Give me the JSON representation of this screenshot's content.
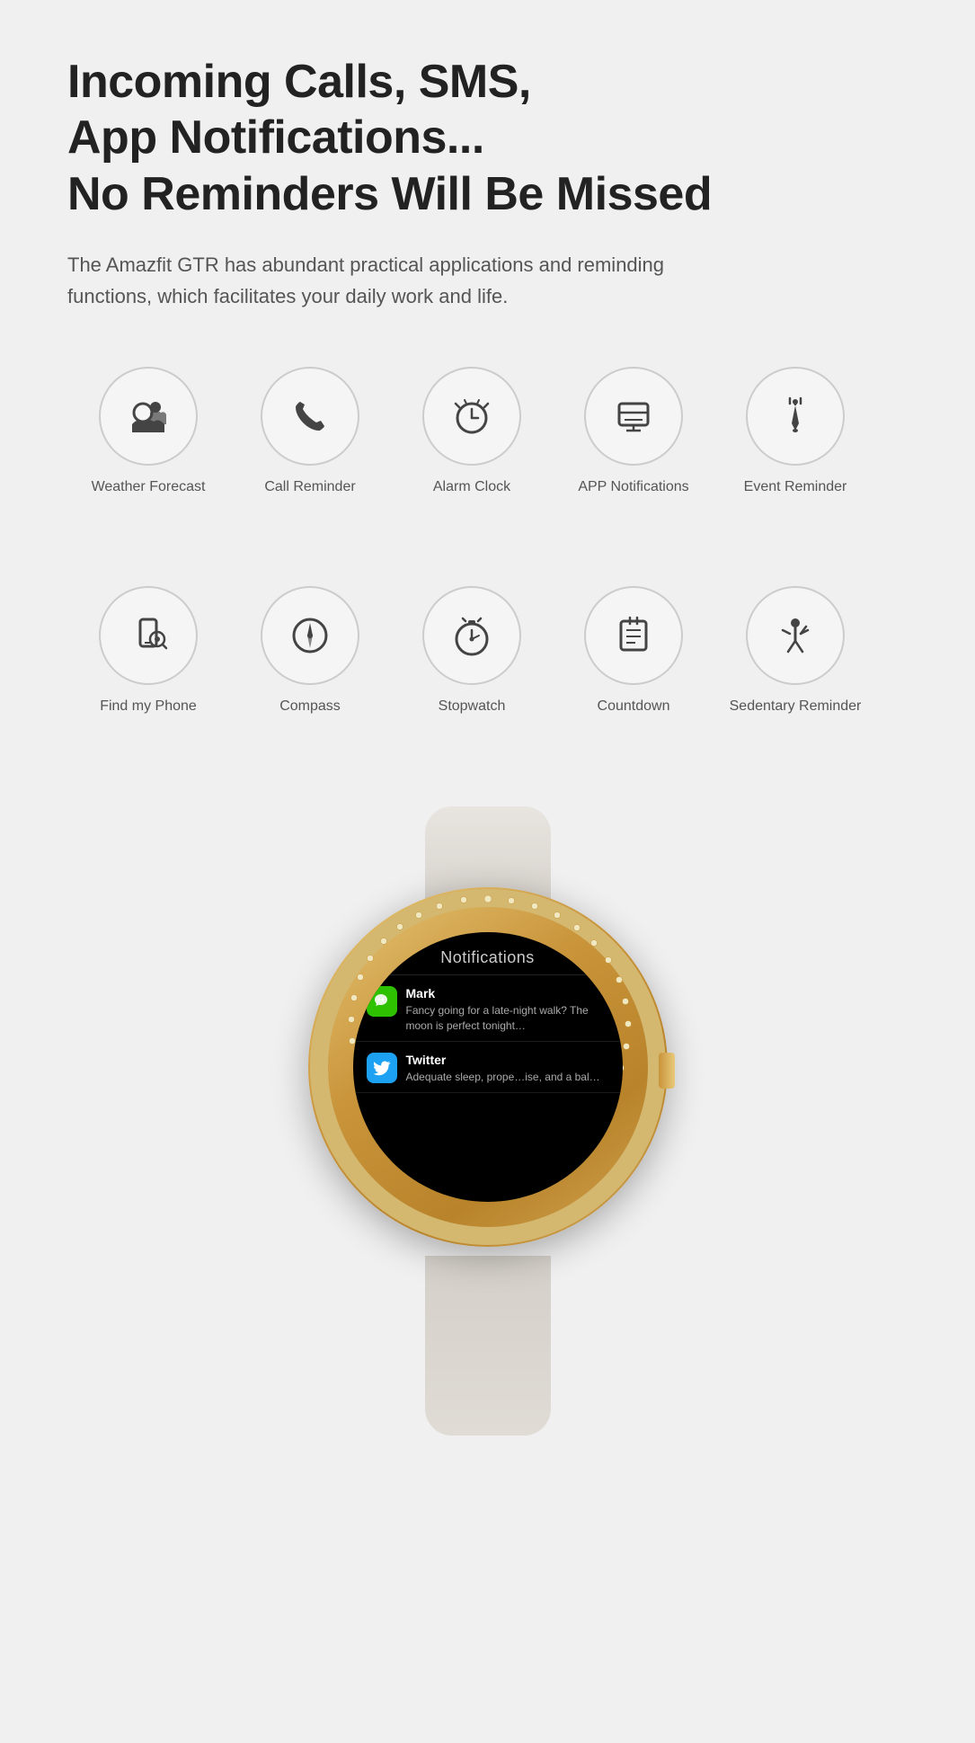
{
  "headline": {
    "line1": "Incoming Calls, SMS,",
    "line2": "App Notifications...",
    "line3": "No Reminders Will Be Missed"
  },
  "description": "The Amazfit GTR has abundant practical applications and reminding functions, which facilitates your daily work and life.",
  "icons_row1": [
    {
      "id": "weather-forecast",
      "label": "Weather Forecast",
      "icon": "weather"
    },
    {
      "id": "call-reminder",
      "label": "Call Reminder",
      "icon": "call"
    },
    {
      "id": "alarm-clock",
      "label": "Alarm Clock",
      "icon": "alarm"
    },
    {
      "id": "app-notifications",
      "label": "APP Notifications",
      "icon": "notification"
    },
    {
      "id": "event-reminder",
      "label": "Event Reminder",
      "icon": "event"
    }
  ],
  "icons_row2": [
    {
      "id": "find-my-phone",
      "label": "Find my Phone",
      "icon": "findphone"
    },
    {
      "id": "compass",
      "label": "Compass",
      "icon": "compass"
    },
    {
      "id": "stopwatch",
      "label": "Stopwatch",
      "icon": "stopwatch"
    },
    {
      "id": "countdown",
      "label": "Countdown",
      "icon": "countdown"
    },
    {
      "id": "sedentary-reminder",
      "label": "Sedentary Reminder",
      "icon": "sedentary"
    }
  ],
  "watch": {
    "screen_title": "Notifications",
    "notifications": [
      {
        "app": "Mark",
        "platform": "wechat",
        "message": "Fancy going for a late-night walk? The moon is perfect tonight…"
      },
      {
        "app": "Twitter",
        "platform": "twitter",
        "message": "Adequate sleep, prope…ise, and a bal…"
      }
    ]
  }
}
